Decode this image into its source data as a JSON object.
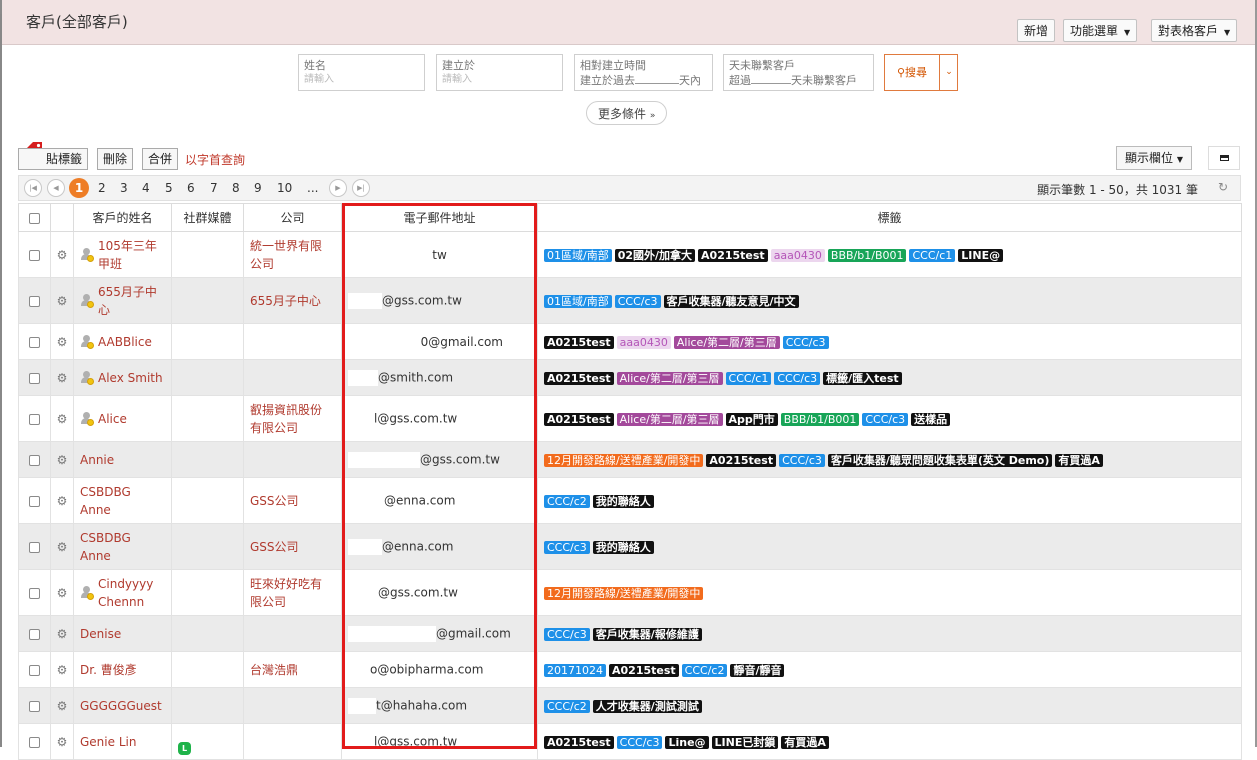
{
  "header": {
    "title": "客戶(全部客戶)",
    "buttons": {
      "add": "新增",
      "function_menu": "功能選單",
      "table_target": "對表格客戶"
    }
  },
  "filters": {
    "name": {
      "label": "姓名",
      "placeholder": "請輸入"
    },
    "created": {
      "label": "建立於",
      "placeholder": "請輸入"
    },
    "relative_created": {
      "label": "相對建立時間",
      "prefix": "建立於過去",
      "suffix": "天內"
    },
    "no_contact": {
      "label": "天未聯繫客戶",
      "prefix": "超過",
      "suffix": "天未聯繫客戶"
    },
    "search_label": "搜尋",
    "more_conditions": "更多條件"
  },
  "toolbar": {
    "tag_label": "貼標籤",
    "delete_label": "刪除",
    "merge_label": "合併",
    "alpha_search": "以字首查詢",
    "show_columns": "顯示欄位"
  },
  "pagination": {
    "pages": [
      "1",
      "2",
      "3",
      "4",
      "5",
      "6",
      "7",
      "8",
      "9",
      "10",
      "..."
    ],
    "current": "1",
    "info": "顯示筆數 1 - 50，共 1031 筆"
  },
  "table": {
    "headers": {
      "name": "客戶的姓名",
      "social": "社群媒體",
      "company": "公司",
      "email": "電子郵件地址",
      "tags": "標籤"
    },
    "rows": [
      {
        "name_l1": "105年三年",
        "name_l2": "甲班",
        "company_l1": "統一世界有限",
        "company_l2": "公司",
        "email": "tw",
        "tags": [
          "01區域/南部",
          "02國外/加拿大",
          "A0215test",
          "aaa0430",
          "BBB/b1/B001",
          "CCC/c1",
          "LINE@"
        ]
      },
      {
        "name_l1": "655月子中",
        "name_l2": "心",
        "company_l1": "655月子中心",
        "company_l2": "",
        "email": "@gss.com.tw",
        "tags": [
          "01區域/南部",
          "CCC/c3",
          "客戶收集器/聽友意見/中文"
        ]
      },
      {
        "name_l1": "AABBlice",
        "name_l2": "",
        "company_l1": "",
        "company_l2": "",
        "email": "0@gmail.com",
        "tags": [
          "A0215test",
          "aaa0430",
          "Alice/第二層/第三層",
          "CCC/c3"
        ]
      },
      {
        "name_l1": "Alex Smith",
        "name_l2": "",
        "company_l1": "",
        "company_l2": "",
        "email": "@smith.com",
        "tags": [
          "A0215test",
          "Alice/第二層/第三層",
          "CCC/c1",
          "CCC/c3",
          "標籤/匯入test"
        ]
      },
      {
        "name_l1": "Alice",
        "name_l2": "",
        "company_l1": "叡揚資訊股份",
        "company_l2": "有限公司",
        "email": "l@gss.com.tw",
        "tags": [
          "A0215test",
          "Alice/第二層/第三層",
          "App門市",
          "BBB/b1/B001",
          "CCC/c3",
          "送樣品"
        ]
      },
      {
        "name_l1": "Annie",
        "name_l2": "",
        "company_l1": "",
        "company_l2": "",
        "email": "@gss.com.tw",
        "tags": [
          "12月開發路線/送禮產業/開發中",
          "A0215test",
          "CCC/c3",
          "客戶收集器/聽眾問題收集表單(英文 Demo)",
          "有買過A"
        ]
      },
      {
        "name_l1": "CSBDBG",
        "name_l2": "Anne",
        "company_l1": "GSS公司",
        "company_l2": "",
        "email": "@enna.com",
        "tags": [
          "CCC/c2",
          "我的聯絡人"
        ]
      },
      {
        "name_l1": "CSBDBG",
        "name_l2": "Anne",
        "company_l1": "GSS公司",
        "company_l2": "",
        "email": "@enna.com",
        "tags": [
          "CCC/c3",
          "我的聯絡人"
        ]
      },
      {
        "name_l1": "Cindyyyy",
        "name_l2": "Chennn",
        "company_l1": "旺來好好吃有",
        "company_l2": "限公司",
        "email": "@gss.com.tw",
        "tags": [
          "12月開發路線/送禮產業/開發中"
        ]
      },
      {
        "name_l1": "Denise",
        "name_l2": "",
        "company_l1": "",
        "company_l2": "",
        "email": "@gmail.com",
        "tags": [
          "CCC/c3",
          "客戶收集器/報修維護"
        ]
      },
      {
        "name_l1": "Dr. 曹俊彥",
        "name_l2": "",
        "company_l1": "台灣浩鼎",
        "company_l2": "",
        "email": "o@obipharma.com",
        "tags": [
          "20171024",
          "A0215test",
          "CCC/c2",
          "靜音/靜音"
        ]
      },
      {
        "name_l1": "GGGGGGuest",
        "name_l2": "",
        "company_l1": "",
        "company_l2": "",
        "email": "t@hahaha.com",
        "tags": [
          "CCC/c2",
          "人才收集器/測試測試"
        ]
      },
      {
        "name_l1": "Genie Lin",
        "name_l2": "",
        "company_l1": "",
        "company_l2": "",
        "email": "l@gss.com.tw",
        "tags": [
          "A0215test",
          "CCC/c3",
          "Line@",
          "LINE已封鎖",
          "有買過A"
        ]
      }
    ]
  }
}
